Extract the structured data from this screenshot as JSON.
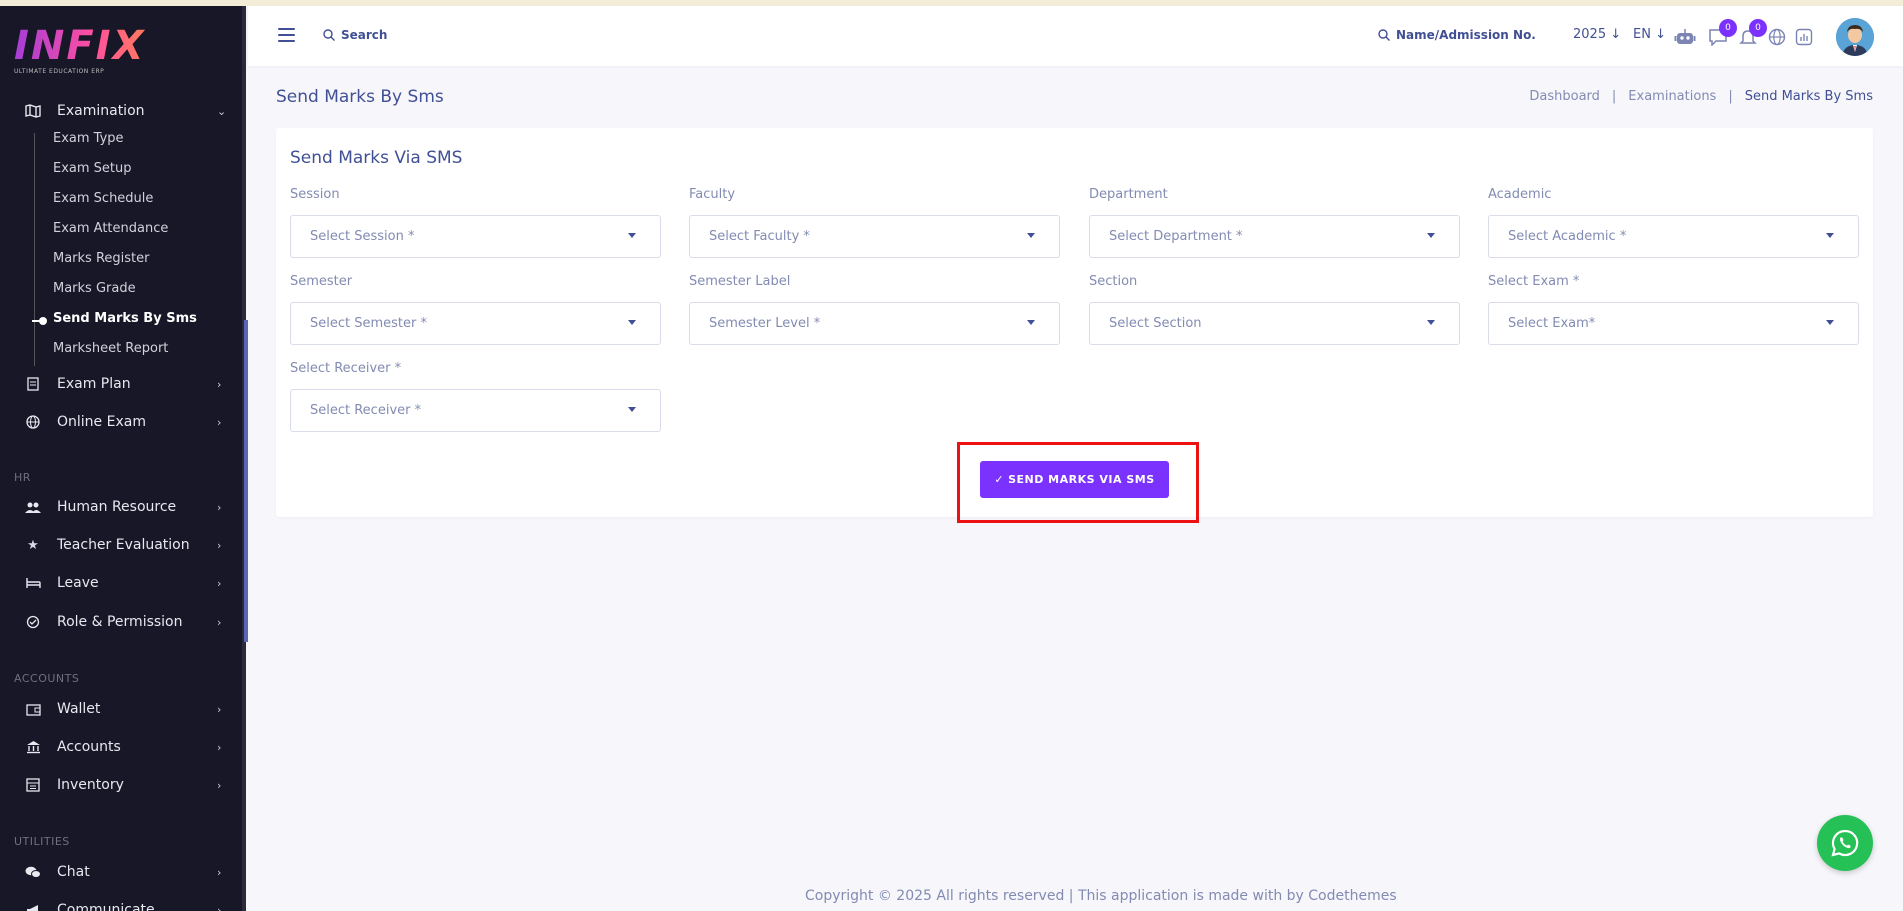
{
  "logo": {
    "text": "INFIX",
    "subtitle": "ULTIMATE EDUCATION ERP"
  },
  "sidebar": {
    "examination": {
      "label": "Examination",
      "icon": "map-icon"
    },
    "sub_items": [
      {
        "label": "Exam Type"
      },
      {
        "label": "Exam Setup"
      },
      {
        "label": "Exam Schedule"
      },
      {
        "label": "Exam Attendance"
      },
      {
        "label": "Marks Register"
      },
      {
        "label": "Marks Grade"
      },
      {
        "label": "Send Marks By Sms",
        "active": true
      },
      {
        "label": "Marksheet Report"
      }
    ],
    "items_top": [
      {
        "label": "Exam Plan",
        "icon": "clipboard-icon"
      },
      {
        "label": "Online Exam",
        "icon": "globe-icon"
      }
    ],
    "hr_heading": "HR",
    "hr_items": [
      {
        "label": "Human Resource",
        "icon": "users-icon"
      },
      {
        "label": "Teacher Evaluation",
        "icon": "star-icon"
      },
      {
        "label": "Leave",
        "icon": "bed-icon"
      },
      {
        "label": "Role & Permission",
        "icon": "shield-icon"
      }
    ],
    "accounts_heading": "ACCOUNTS",
    "accounts_items": [
      {
        "label": "Wallet",
        "icon": "wallet-icon"
      },
      {
        "label": "Accounts",
        "icon": "bank-icon"
      },
      {
        "label": "Inventory",
        "icon": "inventory-icon"
      }
    ],
    "utilities_heading": "UTILITIES",
    "utilities_items": [
      {
        "label": "Chat",
        "icon": "chat-icon"
      },
      {
        "label": "Communicate",
        "icon": "megaphone-icon"
      }
    ]
  },
  "header": {
    "search_label": "Search",
    "name_search_label": "Name/Admission No.",
    "year": "2025",
    "language": "EN",
    "messages_count": "0",
    "notifications_count": "0"
  },
  "page": {
    "title": "Send Marks By Sms",
    "breadcrumb": [
      "Dashboard",
      "Examinations",
      "Send Marks By Sms"
    ]
  },
  "form": {
    "title": "Send Marks Via SMS",
    "fields": [
      {
        "label": "Session",
        "placeholder": "Select Session *"
      },
      {
        "label": "Faculty",
        "placeholder": "Select Faculty *"
      },
      {
        "label": "Department",
        "placeholder": "Select Department *"
      },
      {
        "label": "Academic",
        "placeholder": "Select Academic *"
      },
      {
        "label": "Semester",
        "placeholder": "Select Semester *"
      },
      {
        "label": "Semester Label",
        "placeholder": "Semester Level *"
      },
      {
        "label": "Section",
        "placeholder": "Select Section"
      },
      {
        "label": "Select Exam *",
        "placeholder": "Select Exam*"
      },
      {
        "label": "Select Receiver *",
        "placeholder": "Select Receiver *"
      }
    ],
    "submit_label": "SEND MARKS VIA SMS",
    "submit_check": "✓"
  },
  "footer": {
    "text": "Copyright © 2025 All rights reserved | This application is made with by Codethemes"
  },
  "colors": {
    "accent": "#7c32ff",
    "sidebar_bg": "#171727",
    "text": "#415094",
    "whatsapp": "#25c156",
    "highlight": "#ee1111"
  }
}
